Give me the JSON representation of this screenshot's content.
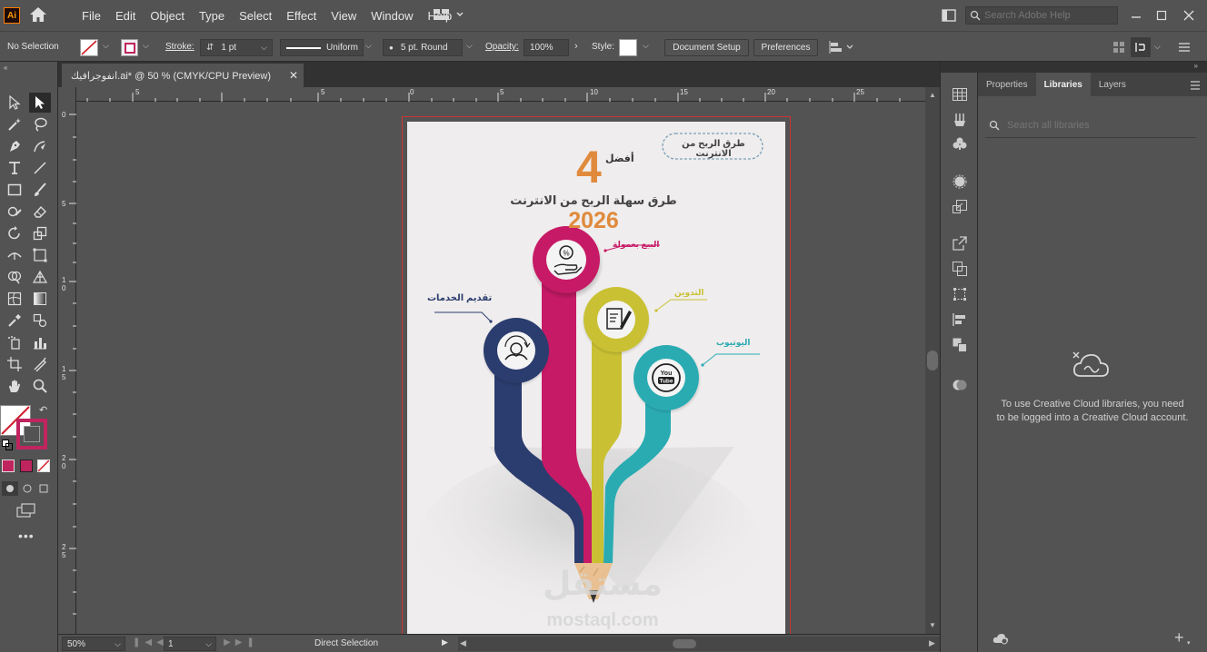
{
  "app": {
    "logo": "Ai",
    "menu": [
      "File",
      "Edit",
      "Object",
      "Type",
      "Select",
      "Effect",
      "View",
      "Window",
      "Help"
    ],
    "search_placeholder": "Search Adobe Help"
  },
  "controlbar": {
    "selection": "No Selection",
    "stroke_label": "Stroke:",
    "stroke_value": "1 pt",
    "profile": "Uniform",
    "brush": "5 pt. Round",
    "opacity_label": "Opacity:",
    "opacity_value": "100%",
    "style_label": "Style:",
    "document_setup": "Document Setup",
    "preferences": "Preferences"
  },
  "document": {
    "tab_title": "انفوجرافيك.ai* @ 50 % (CMYK/CPU Preview)",
    "artboard_number": "1"
  },
  "ruler": {
    "top": [
      "5",
      "0",
      "5",
      "10",
      "15",
      "20",
      "25"
    ],
    "left": [
      "0",
      "5",
      "1\n0",
      "1\n5",
      "2\n0",
      "2\n5"
    ]
  },
  "infographic": {
    "badge": "طرق الربح من الانترنت",
    "afdal": "أفضل",
    "big_number": "4",
    "subtitle": "طرق سهلة الربح من الانترنت",
    "year": "2026",
    "labels": {
      "pink": "البيع بعمولة",
      "blue": "تقديم الخدمات",
      "yellow": "التدوين",
      "teal": "اليوتيوب"
    },
    "youtube_icon_text": [
      "You",
      "Tube"
    ],
    "watermark_ar": "مستقل",
    "watermark_en": "mostaql.com"
  },
  "statusbar": {
    "zoom": "50%",
    "artboard": "1",
    "tool": "Direct Selection"
  },
  "rightpanel": {
    "tabs": [
      "Properties",
      "Libraries",
      "Layers"
    ],
    "active_tab": "Libraries",
    "search_placeholder": "Search all libraries",
    "message": "To use Creative Cloud libraries, you need to be logged into a Creative Cloud account."
  },
  "colors": {
    "pink": "#c71a66",
    "navy": "#2b3d6e",
    "yellow": "#c9c133",
    "teal": "#2aabb2",
    "orange": "#e08a3c",
    "accent_fill": "#c0245e"
  }
}
